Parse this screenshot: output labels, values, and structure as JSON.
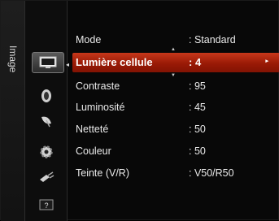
{
  "category": {
    "label": "Image"
  },
  "icons": [
    {
      "name": "picture-icon",
      "active": true
    },
    {
      "name": "sound-icon",
      "active": false
    },
    {
      "name": "channel-icon",
      "active": false
    },
    {
      "name": "setup-icon",
      "active": false
    },
    {
      "name": "input-icon",
      "active": false
    },
    {
      "name": "support-icon",
      "active": false
    }
  ],
  "help_glyph": "?",
  "menu": {
    "items": [
      {
        "label": "Mode",
        "value": ": Standard"
      },
      {
        "label": "Lumière cellule",
        "value": ": 4"
      },
      {
        "label": "Contraste",
        "value": ": 95"
      },
      {
        "label": "Luminosité",
        "value": ": 45"
      },
      {
        "label": "Netteté",
        "value": ": 50"
      },
      {
        "label": "Couleur",
        "value": ": 50"
      },
      {
        "label": "Teinte (V/R)",
        "value": ": V50/R50"
      }
    ],
    "selected_index": 1
  },
  "colors": {
    "highlight": "#b0280f",
    "text": "#e9e9e9"
  }
}
